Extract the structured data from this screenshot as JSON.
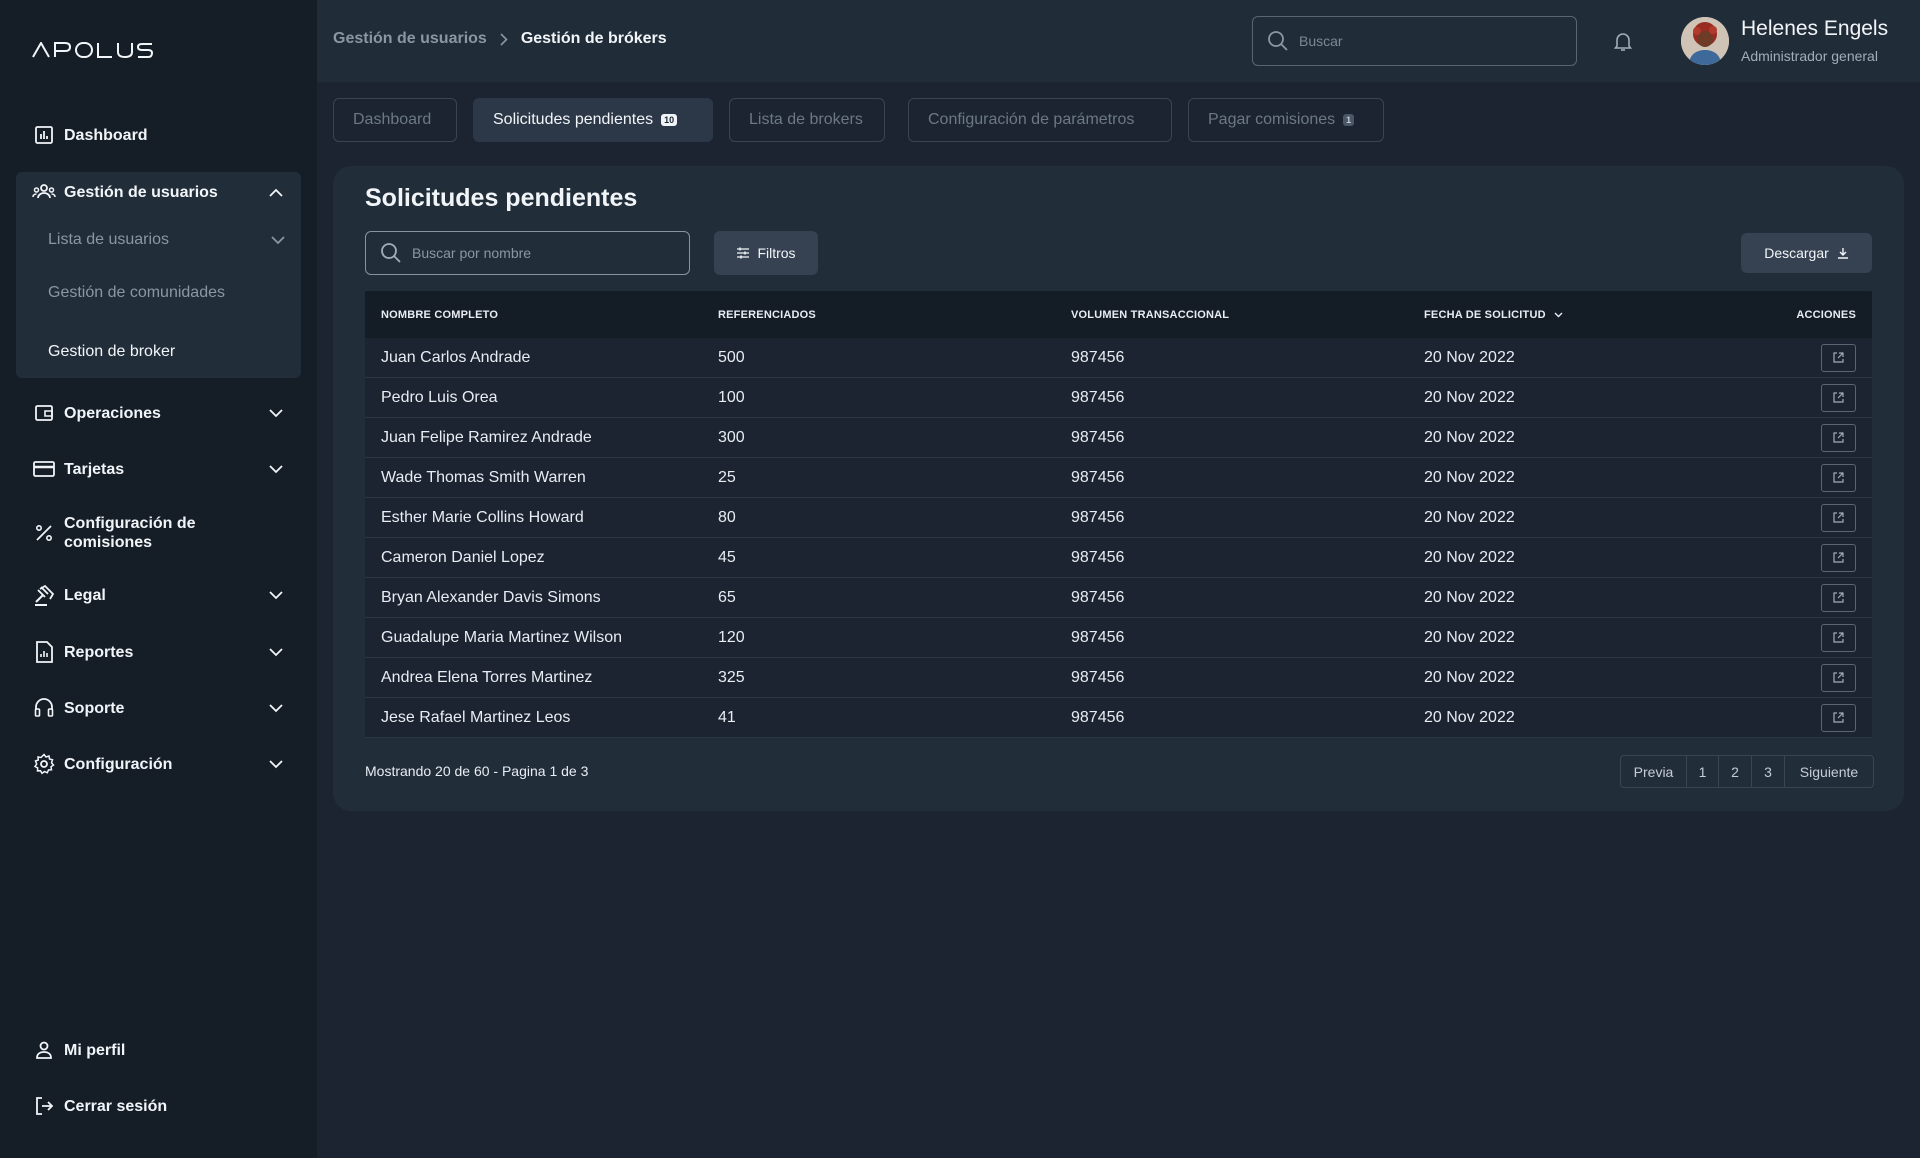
{
  "brand": {
    "logo_text": "APOLUS"
  },
  "sidebar": {
    "dashboard": "Dashboard",
    "user_management": "Gestión de usuarios",
    "user_list": "Lista de usuarios",
    "communities": "Gestión de comunidades",
    "broker": "Gestion de broker",
    "operations": "Operaciones",
    "cards": "Tarjetas",
    "commission_config_1": "Configuración de",
    "commission_config_2": "comisiones",
    "legal": "Legal",
    "reports": "Reportes",
    "support": "Soporte",
    "settings": "Configuración",
    "profile": "Mi perfil",
    "logout": "Cerrar sesión"
  },
  "header": {
    "breadcrumb_parent": "Gestión de usuarios",
    "breadcrumb_current": "Gestión de brókers",
    "search_placeholder": "Buscar",
    "user_name": "Helenes Engels",
    "user_role": "Administrador general"
  },
  "tabs": [
    {
      "label": "Dashboard"
    },
    {
      "label": "Solicitudes pendientes",
      "badge": "10"
    },
    {
      "label": "Lista de brokers"
    },
    {
      "label": "Configuración de parámetros"
    },
    {
      "label": "Pagar comisiones",
      "badge": "1"
    }
  ],
  "panel": {
    "title": "Solicitudes pendientes",
    "search_placeholder": "Buscar por nombre",
    "filter_label": "Filtros",
    "download_label": "Descargar"
  },
  "table": {
    "headers": {
      "name": "NOMBRE COMPLETO",
      "referred": "REFERENCIADOS",
      "volume": "VOLUMEN TRANSACCIONAL",
      "date": "FECHA DE SOLICITUD",
      "actions": "ACCIONES"
    },
    "rows": [
      {
        "name": "Juan Carlos Andrade",
        "referred": "500",
        "volume": "987456",
        "date": "20 Nov 2022"
      },
      {
        "name": "Pedro Luis Orea",
        "referred": "100",
        "volume": "987456",
        "date": "20 Nov 2022"
      },
      {
        "name": "Juan Felipe Ramirez Andrade",
        "referred": "300",
        "volume": "987456",
        "date": "20 Nov 2022"
      },
      {
        "name": "Wade Thomas Smith Warren",
        "referred": "25",
        "volume": "987456",
        "date": "20 Nov 2022"
      },
      {
        "name": "Esther Marie Collins Howard",
        "referred": "80",
        "volume": "987456",
        "date": "20 Nov 2022"
      },
      {
        "name": "Cameron Daniel Lopez",
        "referred": "45",
        "volume": "987456",
        "date": "20 Nov 2022"
      },
      {
        "name": "Bryan Alexander Davis Simons",
        "referred": "65",
        "volume": "987456",
        "date": "20 Nov 2022"
      },
      {
        "name": "Guadalupe Maria Martinez Wilson",
        "referred": "120",
        "volume": "987456",
        "date": "20 Nov 2022"
      },
      {
        "name": "Andrea Elena Torres Martinez",
        "referred": "325",
        "volume": "987456",
        "date": "20 Nov 2022"
      },
      {
        "name": "Jese Rafael Martinez Leos",
        "referred": "41",
        "volume": "987456",
        "date": "20 Nov 2022"
      }
    ]
  },
  "pagination": {
    "info": "Mostrando 20 de 60 - Pagina 1 de 3",
    "prev": "Previa",
    "pages": [
      "1",
      "2",
      "3"
    ],
    "next": "Siguiente"
  }
}
